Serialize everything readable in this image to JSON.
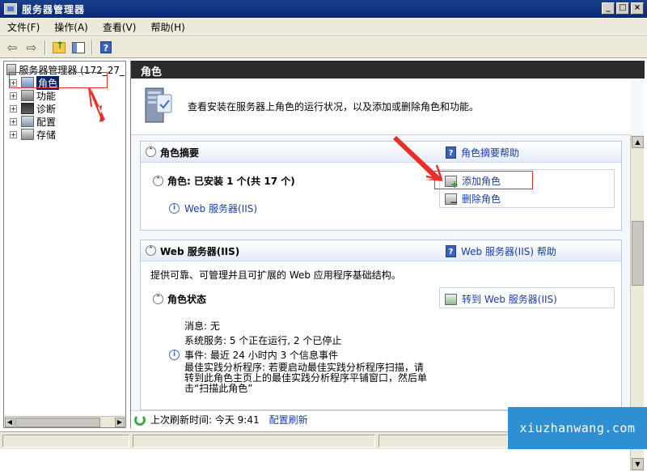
{
  "window": {
    "title": "服务器管理器"
  },
  "menu": [
    "文件(F)",
    "操作(A)",
    "查看(V)",
    "帮助(H)"
  ],
  "tree": {
    "root": "服务器管理器 (172_27_",
    "items": [
      {
        "label": "角色",
        "selected": true
      },
      {
        "label": "功能"
      },
      {
        "label": "诊断"
      },
      {
        "label": "配置"
      },
      {
        "label": "存储"
      }
    ]
  },
  "content": {
    "header": "角色",
    "intro": "查看安装在服务器上角色的运行状况，以及添加或删除角色和功能。",
    "summary_panel": {
      "title": "角色摘要",
      "help": "角色摘要帮助",
      "roles_line": "角色: 已安装 1 个(共 17 个)",
      "role_link": "Web 服务器(IIS)",
      "add_role": "添加角色",
      "remove_role": "删除角色"
    },
    "iis_panel": {
      "title": "Web 服务器(IIS)",
      "help": "Web 服务器(IIS) 帮助",
      "description": "提供可靠、可管理并且可扩展的 Web 应用程序基础结构。",
      "status_title": "角色状态",
      "goto": "转到 Web 服务器(IIS)",
      "messages": "消息: 无",
      "services": "系统服务: 5 个正在运行, 2 个已停止",
      "events": "事件: 最近 24 小时内 3 个信息事件",
      "bpa_line1": "最佳实践分析程序: 若要启动最佳实践分析程序扫描，请",
      "bpa_line2": "转到此角色主页上的最佳实践分析程序平铺窗口，然后单",
      "bpa_line3": "击“扫描此角色”"
    },
    "refresh": {
      "text": "上次刷新时间: 今天 9:41",
      "config": "配置刷新"
    }
  },
  "watermark": "xiuzhanwang.com"
}
